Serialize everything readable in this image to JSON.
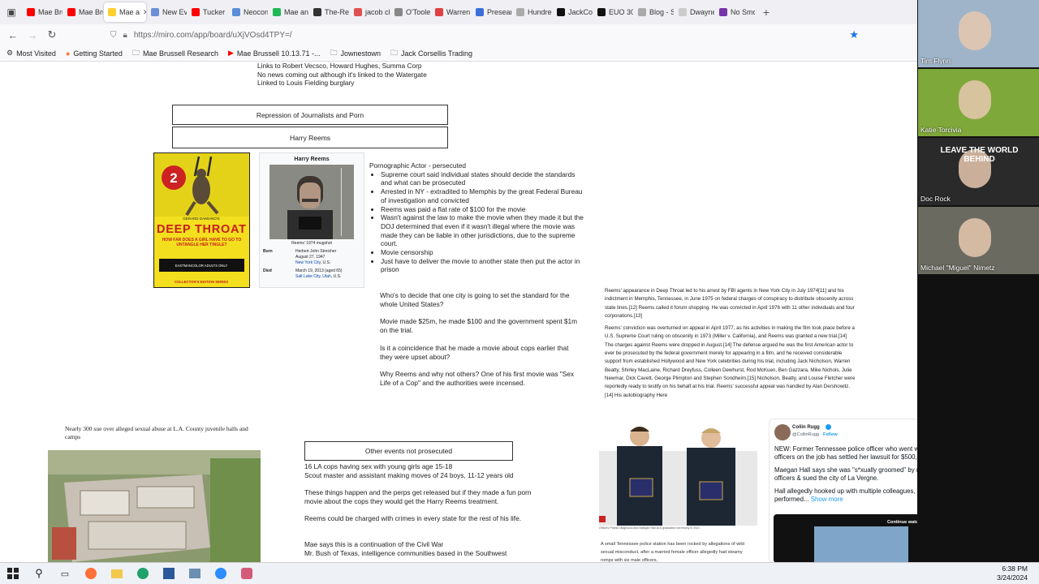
{
  "tabs": [
    {
      "label": "Mae Bru",
      "fav": "#ff0000"
    },
    {
      "label": "Mae Bru",
      "fav": "#ff0000"
    },
    {
      "label": "Mae a",
      "fav": "#ffd02f",
      "active": true,
      "close": "✕"
    },
    {
      "label": "New Evi",
      "fav": "#6b8fd6"
    },
    {
      "label": "Tucker",
      "fav": "#ff0000"
    },
    {
      "label": "Neocon",
      "fav": "#5a8fd6"
    },
    {
      "label": "Mae and",
      "fav": "#1db954"
    },
    {
      "label": "The-Reb",
      "fav": "#333333"
    },
    {
      "label": "jacob ch",
      "fav": "#e05050"
    },
    {
      "label": "O'Toole",
      "fav": "#888888"
    },
    {
      "label": "Warren",
      "fav": "#e04040"
    },
    {
      "label": "Presear",
      "fav": "#3a6fd8"
    },
    {
      "label": "Hundreds su",
      "fav": "#aaaaaa"
    },
    {
      "label": "JackCor",
      "fav": "#111111"
    },
    {
      "label": "EUO 30.",
      "fav": "#111111"
    },
    {
      "label": "Blog - Socrat",
      "fav": "#aaaaaa"
    },
    {
      "label": "Dwayne",
      "fav": "#cccccc"
    },
    {
      "label": "No Smo",
      "fav": "#7733aa"
    }
  ],
  "url": "https://miro.com/app/board/uXjVOsd4TPY=/",
  "bookmarks": [
    {
      "label": "Most Visited",
      "icon": "gear-icon"
    },
    {
      "label": "Getting Started",
      "icon": "firefox-icon"
    },
    {
      "label": "Mae Brussell Research",
      "icon": "folder-icon"
    },
    {
      "label": "Mae Brussell 10.13.71 -...",
      "icon": "youtube-icon"
    },
    {
      "label": "Jownestown",
      "icon": "folder-icon"
    },
    {
      "label": "Jack Corsellis Trading",
      "icon": "folder-icon"
    }
  ],
  "top_notes": [
    "Links to Robert Vecsco, Howard Hughes, Summa Corp",
    "No news coming out although it's linked to the Watergate",
    "Linked to Louis Fielding burglary"
  ],
  "box_repression": "Repression of Journalists and Porn",
  "box_harry": "Harry Reems",
  "poster": {
    "title": "DEEP THROAT",
    "tagline": "HOW FAR DOES A GIRL HAVE TO GO TO UNTANGLE HER TINGLE?",
    "badge": "2",
    "bottom1": "EASTMANCOLOR ADULTS ONLY",
    "bottom2": "COLLECTOR'S EDITION SERIES",
    "credit": "GERARD DAMIANO'S"
  },
  "infobox": {
    "name": "Harry Reems",
    "caption": "Reems' 1974 mugshot",
    "born_label": "Born",
    "born_name": "Herbert John Streicher",
    "born_date": "August 27, 1947",
    "born_place": "New York City",
    "born_place2": ", U.S.",
    "died_label": "Died",
    "died_date": "March 19, 2013 (aged 65)",
    "died_place": "Salt Lake City",
    "died_place2": ", Utah",
    "died_place3": ", U.S."
  },
  "notes_title": "Pornographic Actor - persecuted",
  "notes_bullets": [
    "Supreme court said individual states should decide the standards and what can be prosecuted",
    "Arrested in NY - extradited to Memphis by the great Federal Bureau of investigation and convicted",
    "Reems was paid a flat rate of $100 for the movie",
    "Wasn't against the law to make the movie when they made it but the DOJ determined that even if it wasn't illegal where the movie was made they can be liable in other jurisdictions, due to the supreme court.",
    "Movie censorship",
    "Just have to deliver the movie to another state then put the actor in prison"
  ],
  "questions": [
    "Who's to decide that one city is going to set the standard for the whole United States?",
    "Movie made $25m, he made $100 and the government spent $1m on the trial.",
    "Is it a coincidence that he made a movie about cops earlier that they were upset about?",
    "Why Reems and why not others? One of his first movie was \"Sex Life of a Cop\" and the authorities were incensed."
  ],
  "wiki_p1": "Reems' appearance in Deep Throat led to his arrest by FBI agents in New York City in July 1974[11] and his indictment in Memphis, Tennessee, in June 1975 on federal charges of conspiracy to distribute obscenity across state lines.[12] Reems called it forum shopping. He was convicted in April 1976 with 11 other individuals and four corporations.[13]",
  "wiki_p2": "Reems' conviction was overturned on appeal in April 1977, as his activities in making the film took place before a U.S. Supreme Court ruling on obscenity in 1973 (Miller v. California), and Reems was granted a new trial.[14] The charges against Reems were dropped in August.[14] The defense argued he was the first American actor to ever be prosecuted by the federal government merely for appearing in a film, and he received considerable support from established Hollywood and New York celebrities during his trial, including Jack Nicholson, Warren Beatty, Shirley MacLaine, Richard Dreyfuss, Colleen Dewhurst, Rod McKuen, Ben Gazzara, Mike Nichols, Julie Newmar, Dick Cavett, George Plimpton and Stephen Sondheim.[15] Nicholson, Beatty, and Louise Fletcher were reportedly ready to testify on his behalf at his trial. Reems' successful appeal was handled by Alan Dershowitz.[14] His autobiography Here",
  "headline": "Nearly 300 sue over alleged sexual abuse at L.A. County juvenile halls and camps",
  "box_other": "Other events not prosecuted",
  "other_lines": [
    "16 LA cops having sex with young girls age 15-18",
    "Scout master and assistant making moves of 24 boys, 11-12 years old",
    "",
    "These things happen and the perps get released but if they made a fun porn movie about the cops they would get the Harry Reems treatment.",
    "",
    "Reems could be charged with crimes in every state for the rest of his life.",
    "",
    "",
    "Mae says this is a continuation of the Civil War",
    "Mr. Bush of Texas, intelligence communities based in the Southwest"
  ],
  "police_caption": "Officers Patrick Magliocca and Maegan Hall at a graduation ceremony in 2021",
  "news_text": "A small Tennessee police station has been rocked by allegations of wild sexual misconduct, after a married female officer allegedly had steamy romps with six male officers,",
  "tweet": {
    "name": "Collin Rugg",
    "handle": "@CollinRugg",
    "follow": "Follow",
    "p1": "NEW: Former Tennessee police officer who went wild with six officers on the job has settled her lawsuit for $500,000.",
    "p2": "Maegan Hall says she was \"s*xually groomed\" by male police officers & sued the city of La Vergne.",
    "p3": "Hall allegedly hooked up with multiple colleagues, performed...",
    "more": "Show more",
    "video_label": "Continue watching on X"
  },
  "participants": [
    {
      "name": "Tim Flynn",
      "bg": "#9fb4c9"
    },
    {
      "name": "Katie Torcivia",
      "bg": "#7fa83a"
    },
    {
      "name": "Doc Rock",
      "bg": "#2a2a2a",
      "overlay": "LEAVE THE WORLD BEHIND"
    },
    {
      "name": "Michael \"Miguel\" Nimetz",
      "bg": "#6a6a60"
    }
  ],
  "clock": {
    "time": "6:38 PM",
    "date": "3/24/2024"
  }
}
